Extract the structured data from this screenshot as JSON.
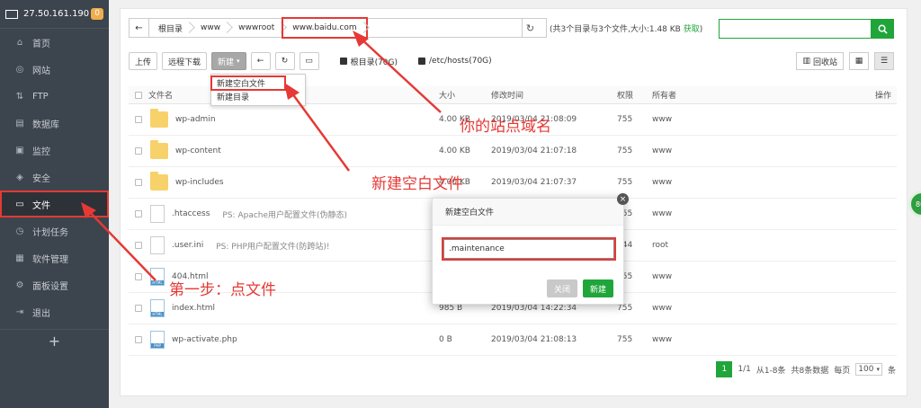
{
  "sidebar": {
    "ip": "27.50.161.190",
    "badge": "0",
    "items": [
      {
        "label": "首页",
        "icon": "home-icon",
        "glyph": "⌂"
      },
      {
        "label": "网站",
        "icon": "globe-icon",
        "glyph": "◎"
      },
      {
        "label": "FTP",
        "icon": "ftp-icon",
        "glyph": "⇅"
      },
      {
        "label": "数据库",
        "icon": "database-icon",
        "glyph": "▤"
      },
      {
        "label": "监控",
        "icon": "monitor-icon",
        "glyph": "▣"
      },
      {
        "label": "安全",
        "icon": "shield-icon",
        "glyph": "◈"
      },
      {
        "label": "文件",
        "icon": "folder-icon",
        "glyph": "▭"
      },
      {
        "label": "计划任务",
        "icon": "clock-icon",
        "glyph": "◷"
      },
      {
        "label": "软件管理",
        "icon": "apps-icon",
        "glyph": "▦"
      },
      {
        "label": "面板设置",
        "icon": "gear-icon",
        "glyph": "⚙"
      },
      {
        "label": "退出",
        "icon": "logout-icon",
        "glyph": "⇥"
      }
    ],
    "add": "+"
  },
  "breadcrumb": {
    "back": "←",
    "items": [
      "根目录",
      "www",
      "wwwroot",
      "www.baidu.com"
    ]
  },
  "dir_info": {
    "text": "(共3个目录与3个文件,大小:1.48 KB ",
    "link": "获取",
    "end": ")"
  },
  "toolbar": {
    "upload": "上传",
    "remote_download": "远程下载",
    "new": "新建",
    "back": "←",
    "refresh": "↻",
    "terminal": "▭",
    "disk_root": "根目录(70G)",
    "disk_hosts": "/etc/hosts(70G)",
    "recycle": "回收站"
  },
  "dropdown": {
    "new_file": "新建空白文件",
    "new_dir": "新建目录"
  },
  "table": {
    "headers": {
      "name": "文件名",
      "size": "大小",
      "time": "修改时间",
      "perm": "权限",
      "owner": "所有者",
      "ops": "操作"
    },
    "rows": [
      {
        "type": "folder",
        "name": "wp-admin",
        "ps": "",
        "size": "4.00 KB",
        "time": "2019/03/04 21:08:09",
        "perm": "755",
        "owner": "www"
      },
      {
        "type": "folder",
        "name": "wp-content",
        "ps": "",
        "size": "4.00 KB",
        "time": "2019/03/04 21:07:18",
        "perm": "755",
        "owner": "www"
      },
      {
        "type": "folder",
        "name": "wp-includes",
        "ps": "",
        "size": "4.00 KB",
        "time": "2019/03/04 21:07:37",
        "perm": "755",
        "owner": "www"
      },
      {
        "type": "doc",
        "name": ".htaccess",
        "ps": "PS: Apache用户配置文件(伪静态)",
        "size": "",
        "time": "",
        "perm": "755",
        "owner": "www"
      },
      {
        "type": "doc",
        "name": ".user.ini",
        "ps": "PS: PHP用户配置文件(防跨站)!",
        "size": "",
        "time": "",
        "perm": "644",
        "owner": "root"
      },
      {
        "type": "html",
        "name": "404.html",
        "ps": "",
        "size": "",
        "time": "",
        "perm": "755",
        "owner": "www"
      },
      {
        "type": "html",
        "name": "index.html",
        "ps": "",
        "size": "985 B",
        "time": "2019/03/04 14:22:34",
        "perm": "755",
        "owner": "www"
      },
      {
        "type": "php",
        "name": "wp-activate.php",
        "ps": "",
        "size": "0 B",
        "time": "2019/03/04 21:08:13",
        "perm": "755",
        "owner": "www"
      }
    ]
  },
  "pager": {
    "current": "1",
    "total_pages": "1/1",
    "range": "从1-8条",
    "count": "共8条数据",
    "per_page_label": "每页",
    "per_page": "100",
    "unit": "条"
  },
  "dialog": {
    "title": "新建空白文件",
    "value": ".maintenance",
    "close": "关闭",
    "ok": "新建",
    "x": "×"
  },
  "annotations": {
    "domain": "你的站点域名",
    "new_file": "新建空白文件",
    "step1": "第一步：点文件"
  },
  "float_badge": "80",
  "colors": {
    "accent": "#20a53a",
    "sidebar": "#3c444d",
    "annotation": "#e53935"
  }
}
